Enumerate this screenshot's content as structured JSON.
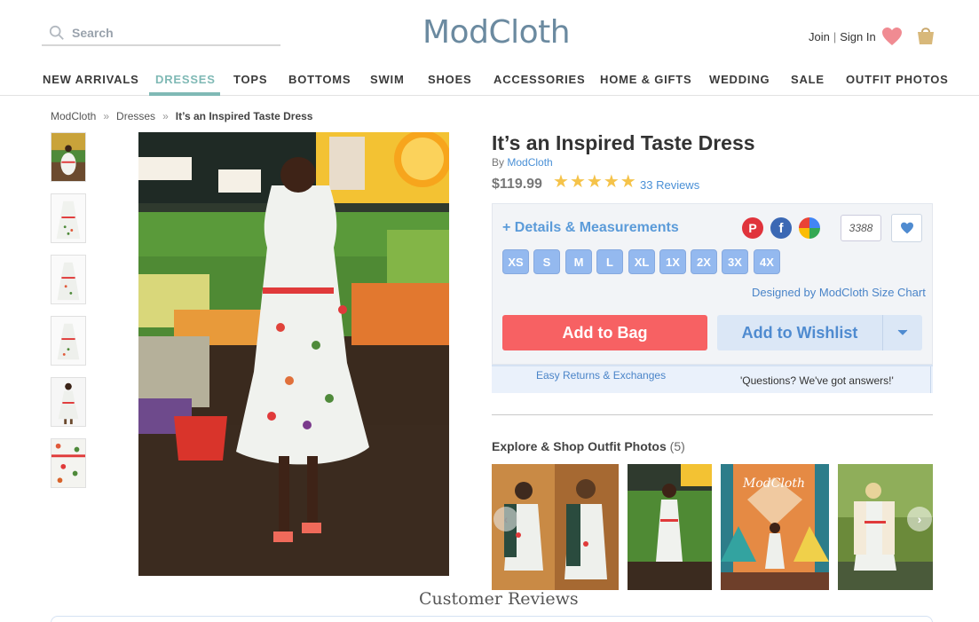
{
  "search": {
    "placeholder": "Search"
  },
  "brand": {
    "logo": "ModCloth"
  },
  "account": {
    "join": "Join",
    "separator": "|",
    "sign_in": "Sign In"
  },
  "nav": {
    "items": [
      "NEW ARRIVALS",
      "DRESSES",
      "TOPS",
      "BOTTOMS",
      "SWIM",
      "SHOES",
      "ACCESSORIES",
      "HOME & GIFTS",
      "WEDDING",
      "SALE",
      "OUTFIT PHOTOS"
    ],
    "active": "DRESSES"
  },
  "breadcrumb": {
    "home": "ModCloth",
    "category": "Dresses",
    "current": "It’s an Inspired Taste Dress",
    "separator": "»"
  },
  "product": {
    "title": "It’s an Inspired Taste Dress",
    "by_label": "By",
    "brand": "ModCloth",
    "price": "$119.99",
    "rating": 5,
    "reviews_label": "33 Reviews",
    "details_label": "+ Details & Measurements",
    "save_count": "3388",
    "sizes": [
      "XS",
      "S",
      "M",
      "L",
      "XL",
      "1X",
      "2X",
      "3X",
      "4X"
    ],
    "size_chart_label": "Designed by ModCloth Size Chart",
    "add_to_bag": "Add to Bag",
    "add_to_wishlist": "Add to Wishlist",
    "easy_returns": "Easy Returns & Exchanges",
    "questions": "'Questions? We've got answers!'"
  },
  "social_icons": [
    "pinterest-icon",
    "facebook-icon",
    "google-plus-icon"
  ],
  "outfit_photos": {
    "label": "Explore & Shop Outfit Photos",
    "count": "(5)"
  },
  "customer_reviews": {
    "heading": "Customer Reviews"
  },
  "colors": {
    "accent_teal": "#7fb9b5",
    "bag_red": "#f76163",
    "link_blue": "#4a90d6",
    "size_blue": "#94b9ef",
    "star_gold": "#f5c34a"
  }
}
